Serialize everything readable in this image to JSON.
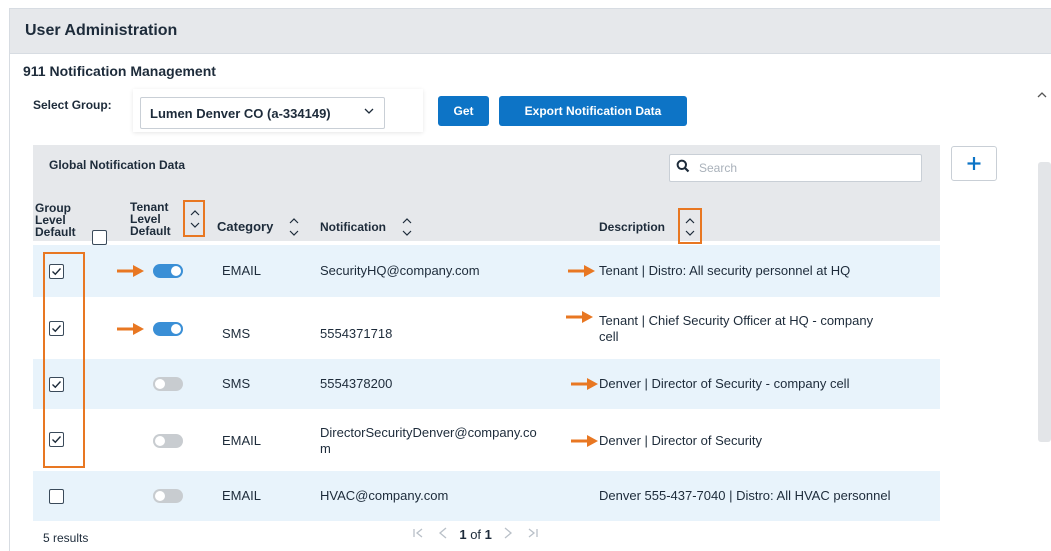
{
  "header": {
    "title": "User Administration"
  },
  "section": {
    "title": "911 Notification Management"
  },
  "select_group": {
    "label": "Select Group:",
    "value": "Lumen Denver CO (a-334149)"
  },
  "buttons": {
    "get": "Get",
    "export": "Export Notification Data",
    "add": "+"
  },
  "panel": {
    "title": "Global Notification Data",
    "search_placeholder": "Search"
  },
  "columns": {
    "group_default": [
      "Group",
      "Level",
      "Default"
    ],
    "tenant_default": [
      "Tenant",
      "Level",
      "Default"
    ],
    "category": "Category",
    "notification": "Notification",
    "description": "Description"
  },
  "rows": [
    {
      "group_checked": true,
      "tenant_on": true,
      "category": "EMAIL",
      "notification": "SecurityHQ@company.com",
      "notification_2": "",
      "description": "Tenant | Distro: All security personnel at HQ",
      "description_2": ""
    },
    {
      "group_checked": true,
      "tenant_on": true,
      "category": "SMS",
      "notification": "5554371718",
      "notification_2": "",
      "description": "Tenant | Chief Security Officer at HQ - company",
      "description_2": "cell"
    },
    {
      "group_checked": true,
      "tenant_on": false,
      "category": "SMS",
      "notification": "5554378200",
      "notification_2": "",
      "description": "Denver | Director of Security - company cell",
      "description_2": ""
    },
    {
      "group_checked": true,
      "tenant_on": false,
      "category": "EMAIL",
      "notification": "DirectorSecurityDenver@company.co",
      "notification_2": "m",
      "description": "Denver | Director of Security",
      "description_2": ""
    },
    {
      "group_checked": false,
      "tenant_on": false,
      "category": "EMAIL",
      "notification": "HVAC@company.com",
      "notification_2": "",
      "description": "Denver 555-437-7040 | Distro: All HVAC personnel",
      "description_2": ""
    }
  ],
  "footer": {
    "count": "5 results",
    "page_current": "1",
    "page_of": "of",
    "page_total": "1"
  },
  "colors": {
    "accent": "#0d74c6",
    "highlight": "#e87722",
    "row_alt": "#e8f3fb",
    "header_bg": "#e6e8eb"
  }
}
